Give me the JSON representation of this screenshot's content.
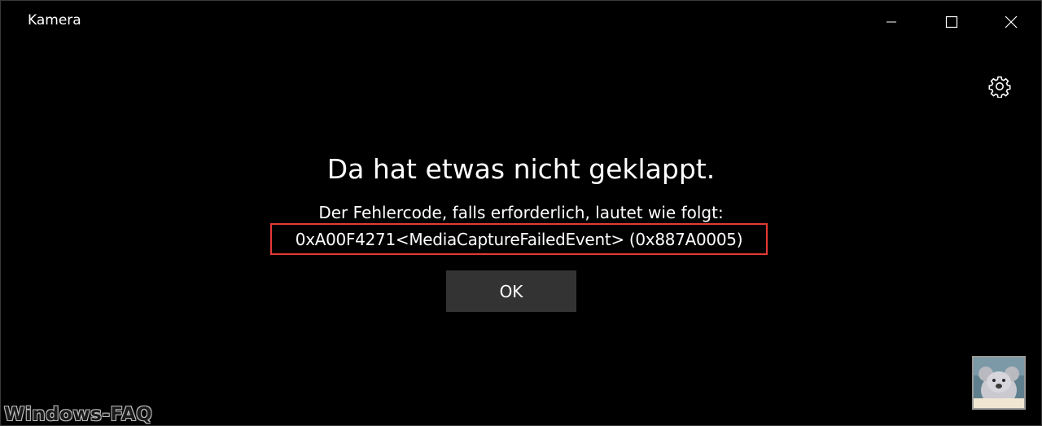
{
  "window": {
    "title": "Kamera",
    "controls": {
      "minimize_icon": "minimize-icon",
      "maximize_icon": "maximize-icon",
      "close_icon": "close-icon"
    }
  },
  "toolbar": {
    "settings_icon": "gear-icon"
  },
  "error": {
    "headline": "Da hat etwas nicht geklappt.",
    "message": "Der Fehlercode, falls erforderlich, lautet wie folgt:",
    "code": "0xA00F4271<MediaCaptureFailedEvent> (0x887A0005)",
    "highlight_color": "#e53935"
  },
  "actions": {
    "ok_label": "OK"
  },
  "gallery": {
    "thumbnail_icon": "photo-thumbnail"
  },
  "watermark": {
    "text": "Windows-FAQ"
  },
  "colors": {
    "background": "#000000",
    "text": "#ffffff",
    "button_bg": "#333333"
  }
}
